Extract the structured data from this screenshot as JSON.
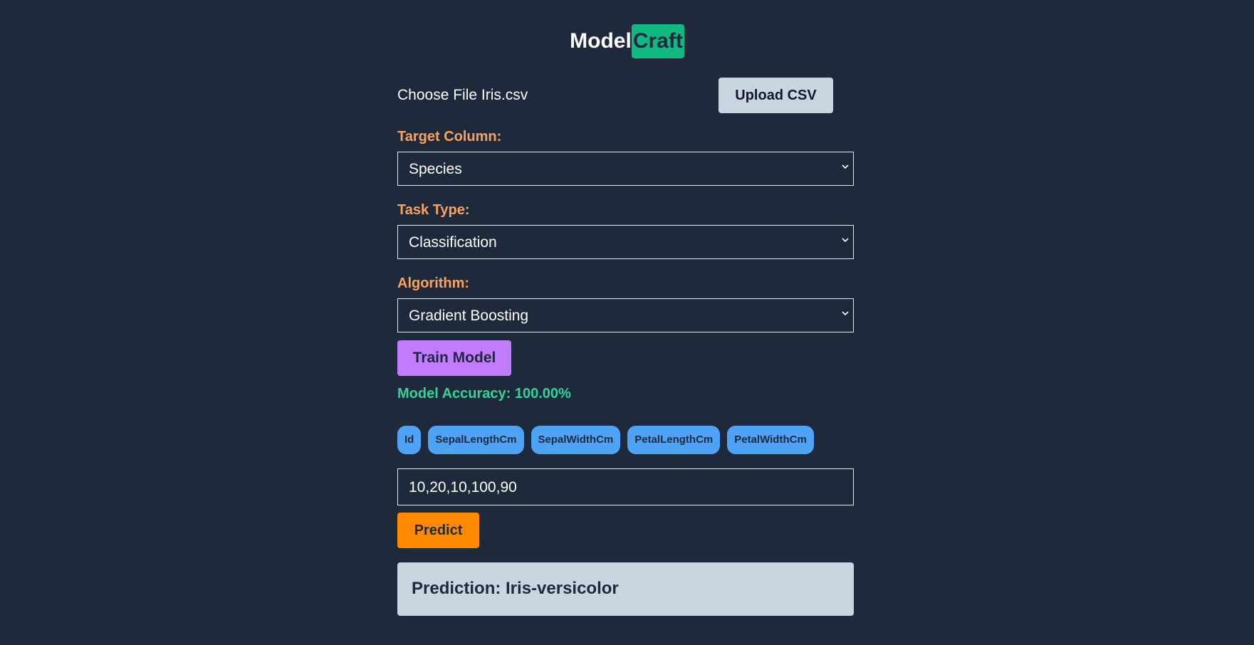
{
  "logo": {
    "part1": "Model",
    "part2": "Craft"
  },
  "file": {
    "choose_label": "Choose File",
    "filename": "Iris.csv",
    "upload_label": "Upload CSV"
  },
  "target": {
    "label": "Target Column:",
    "value": "Species"
  },
  "task": {
    "label": "Task Type:",
    "value": "Classification"
  },
  "algorithm": {
    "label": "Algorithm:",
    "value": "Gradient Boosting"
  },
  "train_label": "Train Model",
  "accuracy_text": "Model Accuracy: 100.00%",
  "features": [
    "Id",
    "SepalLengthCm",
    "SepalWidthCm",
    "PetalLengthCm",
    "PetalWidthCm"
  ],
  "input_value": "10,20,10,100,90",
  "predict_label": "Predict",
  "prediction_text": "Prediction: Iris-versicolor",
  "colors": {
    "background": "#1e293b",
    "brand_accent": "#10b981",
    "label_orange": "#fba35c",
    "train_purple": "#c27aff",
    "accuracy_green": "#34d399",
    "chip_blue": "#4fa3f7",
    "predict_orange": "#ff8a00",
    "result_bg": "#cbd5e1"
  },
  "icons": {
    "select_chevron": "chevron-down-icon"
  }
}
